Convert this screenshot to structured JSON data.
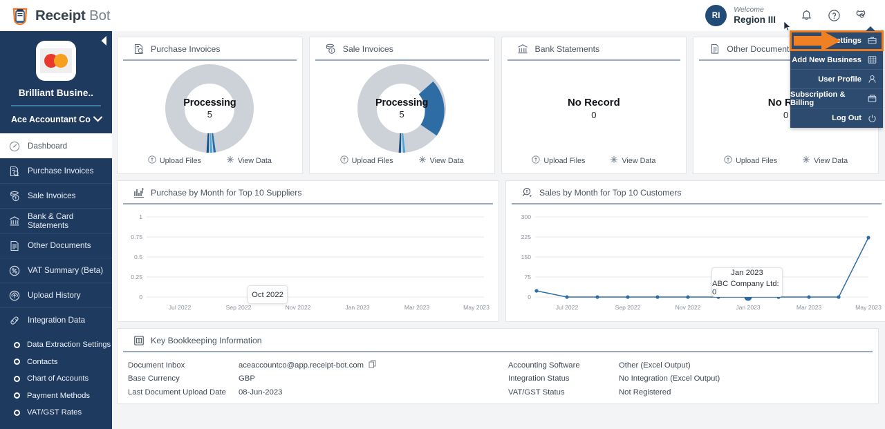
{
  "app": {
    "brand_bold": "Receipt",
    "brand_light": "Bot"
  },
  "header": {
    "avatar_initials": "RI",
    "welcome_label": "Welcome",
    "user_name": "Region III",
    "icons": [
      "bell-icon",
      "help-icon",
      "gear-icon"
    ]
  },
  "dropdown": {
    "items": [
      {
        "label": "Business Settings",
        "icon": "briefcase-icon",
        "highlighted": true
      },
      {
        "label": "Add New Business",
        "icon": "add-building-icon",
        "highlighted": false
      },
      {
        "label": "User Profile",
        "icon": "user-icon",
        "highlighted": false
      },
      {
        "label": "Subscription & Billing",
        "icon": "wallet-icon",
        "highlighted": false
      },
      {
        "label": "Log Out",
        "icon": "power-icon",
        "highlighted": false
      }
    ]
  },
  "sidebar": {
    "business_name": "Brilliant Busine..",
    "business_logo": "mastercard-logo",
    "accountant": "Ace Accountant Co",
    "items": [
      {
        "label": "Dashboard",
        "icon": "speedometer-icon",
        "active": true
      },
      {
        "label": "Purchase Invoices",
        "icon": "purchase-invoice-icon",
        "active": false
      },
      {
        "label": "Sale Invoices",
        "icon": "sale-invoice-icon",
        "active": false
      },
      {
        "label": "Bank & Card Statements",
        "icon": "bank-icon",
        "active": false
      },
      {
        "label": "Other Documents",
        "icon": "document-icon",
        "active": false
      },
      {
        "label": "VAT Summary (Beta)",
        "icon": "percent-icon",
        "active": false
      },
      {
        "label": "Upload History",
        "icon": "upload-cloud-icon",
        "active": false
      },
      {
        "label": "Integration Data",
        "icon": "link-icon",
        "active": false
      }
    ],
    "sub_items": [
      {
        "label": "Data Extraction Settings"
      },
      {
        "label": "Contacts"
      },
      {
        "label": "Chart of Accounts"
      },
      {
        "label": "Payment Methods"
      },
      {
        "label": "VAT/GST Rates"
      }
    ]
  },
  "stat_cards": [
    {
      "title": "Purchase Invoices",
      "icon": "purchase-invoice-icon",
      "status": "Processing",
      "count": "5",
      "has_donut": true,
      "upload_label": "Upload Files",
      "view_label": "View Data"
    },
    {
      "title": "Sale Invoices",
      "icon": "sale-invoice-icon",
      "status": "Processing",
      "count": "5",
      "has_donut": true,
      "upload_label": "Upload Files",
      "view_label": "View Data"
    },
    {
      "title": "Bank Statements",
      "icon": "bank-icon",
      "status": "No Record",
      "count": "0",
      "has_donut": false,
      "upload_label": "Upload Files",
      "view_label": "View Data"
    },
    {
      "title": "Other Documents",
      "icon": "document-icon",
      "status": "No Rec",
      "count": "0",
      "has_donut": false,
      "upload_label": "Upload Files",
      "view_label": "View Data"
    }
  ],
  "chart_data": [
    {
      "type": "line",
      "title": "Purchase by Month for Top 10 Suppliers",
      "icon": "bar-chart-icon",
      "xlabel": "",
      "ylabel": "",
      "ylim": [
        0,
        1
      ],
      "yticks": [
        "0",
        "0.25",
        "0.5",
        "0.75",
        "1"
      ],
      "x": [
        "Jun 2022",
        "Jul 2022",
        "Aug 2022",
        "Sep 2022",
        "Oct 2022",
        "Nov 2022",
        "Dec 2022",
        "Jan 2023",
        "Feb 2023",
        "Mar 2023",
        "Apr 2023",
        "May 2023"
      ],
      "xticks": [
        "Jul 2022",
        "Sep 2022",
        "Nov 2022",
        "Jan 2023",
        "Mar 2023",
        "May 2023"
      ],
      "series": [],
      "grid": true,
      "legend": "none",
      "annotation": {
        "title": "Oct 2022",
        "rows": []
      }
    },
    {
      "type": "line",
      "title": "Sales by Month for Top 10 Customers",
      "icon": "sales-tag-icon",
      "xlabel": "",
      "ylabel": "",
      "ylim": [
        0,
        300
      ],
      "yticks": [
        "0",
        "75",
        "150",
        "225",
        "300"
      ],
      "x": [
        "Jun 2022",
        "Jul 2022",
        "Aug 2022",
        "Sep 2022",
        "Oct 2022",
        "Nov 2022",
        "Dec 2022",
        "Jan 2023",
        "Feb 2023",
        "Mar 2023",
        "Apr 2023",
        "May 2023"
      ],
      "xticks": [
        "Jul 2022",
        "Sep 2022",
        "Nov 2022",
        "Jan 2023",
        "Mar 2023",
        "May 2023"
      ],
      "series": [
        {
          "name": "ABC Company Ltd",
          "values": [
            22,
            0,
            0,
            0,
            0,
            0,
            0,
            0,
            0,
            0,
            0,
            222
          ],
          "color": "#2e6da4"
        }
      ],
      "grid": true,
      "legend": "none",
      "annotation": {
        "title": "Jan 2023",
        "rows": [
          "ABC Company Ltd: 0"
        ],
        "highlight_index": 7
      }
    }
  ],
  "key_info": {
    "title": "Key Bookkeeping Information",
    "icon": "info-box-icon",
    "left_rows": [
      {
        "label": "Document Inbox",
        "value": "aceaccountco@app.receipt-bot.com",
        "copy_icon": "copy-icon"
      },
      {
        "label": "Base Currency",
        "value": "GBP",
        "copy_icon": ""
      },
      {
        "label": "Last Document Upload Date",
        "value": "08-Jun-2023",
        "copy_icon": ""
      }
    ],
    "right_rows": [
      {
        "label": "Accounting Software",
        "value": "Other (Excel Output)",
        "copy_icon": ""
      },
      {
        "label": "Integration Status",
        "value": "No Integration (Excel Output)",
        "copy_icon": ""
      },
      {
        "label": "VAT/GST Status",
        "value": "Not Registered",
        "copy_icon": ""
      }
    ]
  },
  "colors": {
    "sidebar_bg": "#1f3a5f",
    "dropdown_bg": "#2d4a6f",
    "highlight": "#ea7a1e",
    "accent_blue": "#2e6da4",
    "donut_track": "#ccd2d8"
  }
}
